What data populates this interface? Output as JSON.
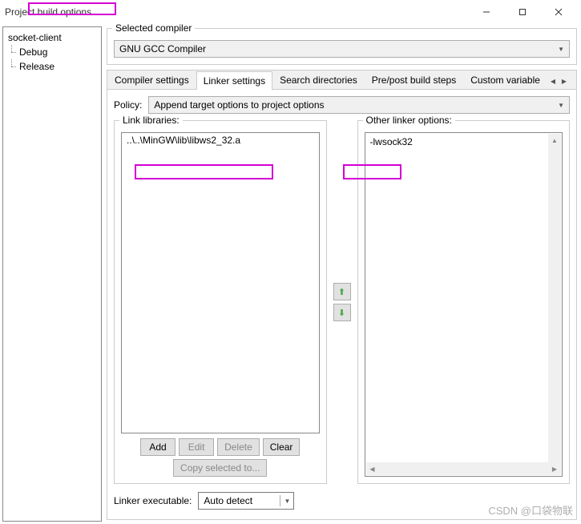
{
  "window": {
    "title": "Project build options"
  },
  "tree": {
    "root": "socket-client",
    "children": [
      "Debug",
      "Release"
    ]
  },
  "compiler": {
    "legend": "Selected compiler",
    "value": "GNU GCC Compiler"
  },
  "tabs": [
    "Compiler settings",
    "Linker settings",
    "Search directories",
    "Pre/post build steps",
    "Custom variable"
  ],
  "active_tab_index": 1,
  "policy": {
    "label": "Policy:",
    "value": "Append target options to project options"
  },
  "link_libraries": {
    "legend": "Link libraries:",
    "items": [
      "..\\..\\MinGW\\lib\\libws2_32.a"
    ]
  },
  "other_options": {
    "legend": "Other linker options:",
    "text": "-lwsock32"
  },
  "buttons": {
    "add": "Add",
    "edit": "Edit",
    "delete": "Delete",
    "clear": "Clear",
    "copy": "Copy selected to..."
  },
  "linker_exec": {
    "label": "Linker executable:",
    "value": "Auto detect"
  },
  "watermark": "CSDN @口袋物联"
}
